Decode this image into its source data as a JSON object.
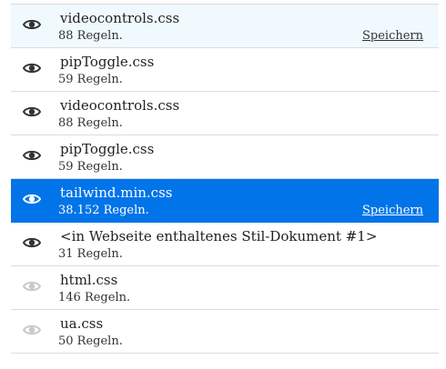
{
  "colors": {
    "selected_bg": "#0074e8",
    "hover_bg": "#f0f9fe",
    "divider": "#dcdcde",
    "eye_active": "#333333",
    "eye_disabled": "#c8c8c8"
  },
  "stylesheets": [
    {
      "name": "videocontrols.css",
      "rules": "88 Regeln.",
      "save_label": "Speichern",
      "show_save": true,
      "state": "hover",
      "eye_icon": "eye-icon",
      "eye_disabled": false
    },
    {
      "name": "pipToggle.css",
      "rules": "59 Regeln.",
      "save_label": "",
      "show_save": false,
      "state": "normal",
      "eye_icon": "eye-icon",
      "eye_disabled": false
    },
    {
      "name": "videocontrols.css",
      "rules": "88 Regeln.",
      "save_label": "",
      "show_save": false,
      "state": "normal",
      "eye_icon": "eye-icon",
      "eye_disabled": false
    },
    {
      "name": "pipToggle.css",
      "rules": "59 Regeln.",
      "save_label": "",
      "show_save": false,
      "state": "normal",
      "eye_icon": "eye-icon",
      "eye_disabled": false
    },
    {
      "name": "tailwind.min.css",
      "rules": "38.152 Regeln.",
      "save_label": "Speichern",
      "show_save": true,
      "state": "selected",
      "eye_icon": "eye-icon",
      "eye_disabled": false
    },
    {
      "name": "<in Webseite enthaltenes Stil-Dokument #1>",
      "rules": "31 Regeln.",
      "save_label": "",
      "show_save": false,
      "state": "normal",
      "eye_icon": "eye-icon",
      "eye_disabled": false
    },
    {
      "name": "html.css",
      "rules": "146 Regeln.",
      "save_label": "",
      "show_save": false,
      "state": "normal",
      "eye_icon": "eye-icon",
      "eye_disabled": true
    },
    {
      "name": "ua.css",
      "rules": "50 Regeln.",
      "save_label": "",
      "show_save": false,
      "state": "normal",
      "eye_icon": "eye-icon",
      "eye_disabled": true
    }
  ]
}
